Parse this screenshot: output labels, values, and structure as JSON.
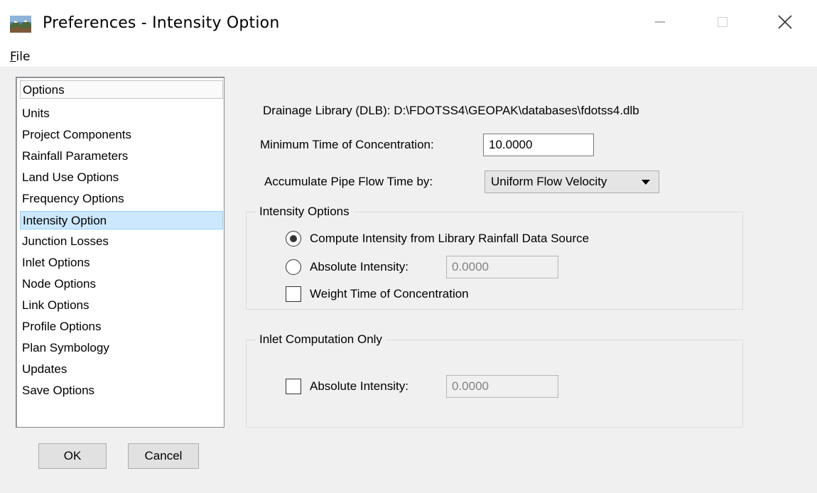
{
  "window": {
    "title": "Preferences - Intensity Option",
    "controls": {
      "minimize_icon": "minimize-icon",
      "maximize_icon": "maximize-icon",
      "close_icon": "close-icon"
    }
  },
  "menu": {
    "file_mnemonic": "F",
    "file_rest": "ile"
  },
  "sidebar": {
    "header": "Options",
    "items": [
      "Units",
      "Project Components",
      "Rainfall Parameters",
      "Land Use Options",
      "Frequency Options",
      "Intensity Option",
      "Junction Losses",
      "Inlet Options",
      "Node Options",
      "Link Options",
      "Profile Options",
      "Plan Symbology",
      "Updates",
      "Save Options"
    ],
    "selected": "Intensity Option"
  },
  "buttons": {
    "ok": "OK",
    "cancel": "Cancel"
  },
  "main": {
    "drainage_library": "Drainage Library (DLB): D:\\FDOTSS4\\GEOPAK\\databases\\fdotss4.dlb",
    "min_toc_label": "Minimum Time of Concentration:",
    "min_toc_value": "10.0000",
    "accumulate_label": "Accumulate Pipe Flow Time by:",
    "accumulate_value": "Uniform Flow Velocity"
  },
  "intensity_group": {
    "legend": "Intensity Options",
    "radio_compute": "Compute Intensity from Library Rainfall Data Source",
    "radio_compute_checked": true,
    "radio_absolute": "Absolute Intensity:",
    "radio_absolute_checked": false,
    "absolute_value": "0.0000",
    "weight_toc": "Weight Time of Concentration",
    "weight_toc_checked": false
  },
  "inlet_group": {
    "legend": "Inlet Computation Only",
    "absolute_label": "Absolute Intensity:",
    "absolute_checked": false,
    "absolute_value": "0.0000"
  }
}
